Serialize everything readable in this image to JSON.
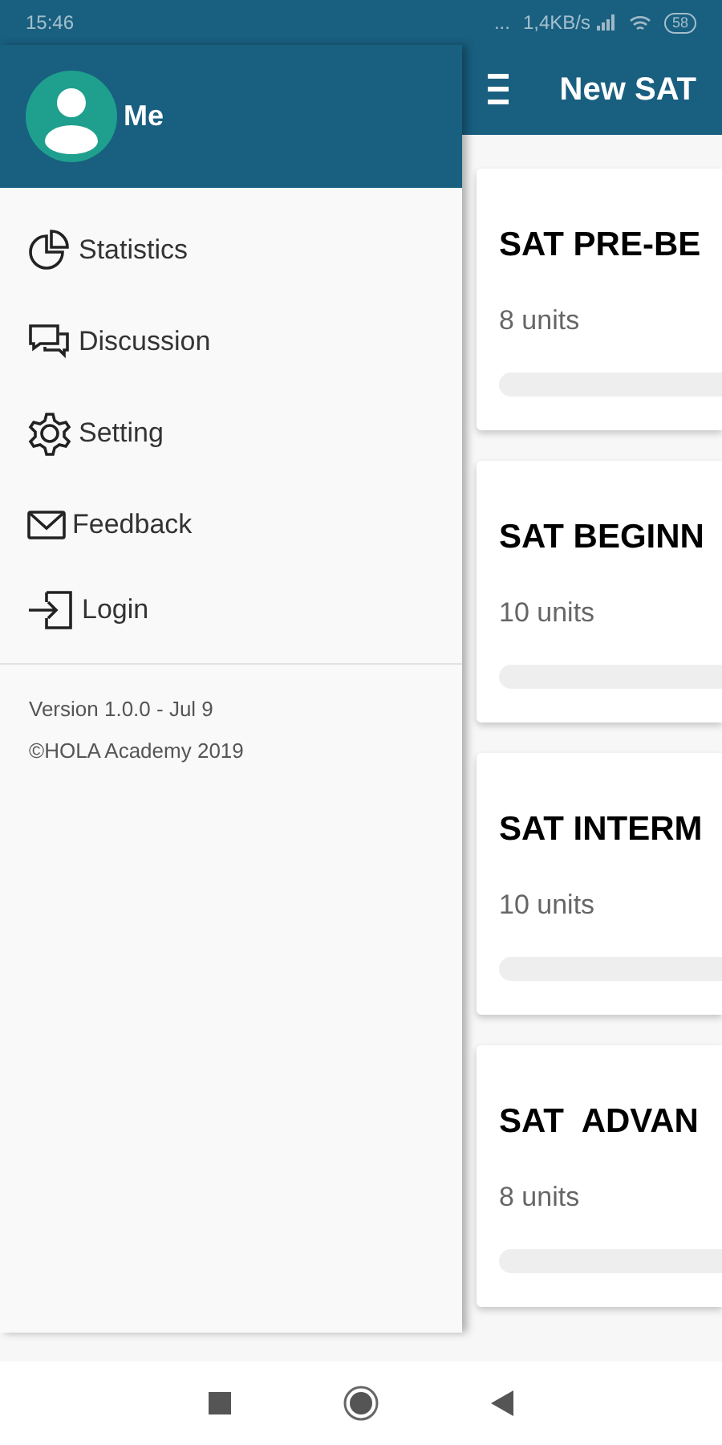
{
  "status_bar": {
    "time": "15:46",
    "dots": "...",
    "speed": "1,4KB/s",
    "battery": "58"
  },
  "drawer": {
    "user": "Me",
    "items": [
      {
        "label": "Statistics"
      },
      {
        "label": "Discussion"
      },
      {
        "label": "Setting"
      },
      {
        "label": "Feedback"
      },
      {
        "label": "Login"
      }
    ],
    "version": "Version 1.0.0 - Jul 9",
    "copyright": "©HOLA Academy 2019"
  },
  "app_bar": {
    "title": "New SAT"
  },
  "courses": [
    {
      "title": "SAT PRE-BE",
      "units": "8 units"
    },
    {
      "title": "SAT BEGINN",
      "units": "10 units"
    },
    {
      "title": "SAT INTERM",
      "units": "10 units"
    },
    {
      "title": "SAT  ADVAN",
      "units": "8 units"
    }
  ]
}
